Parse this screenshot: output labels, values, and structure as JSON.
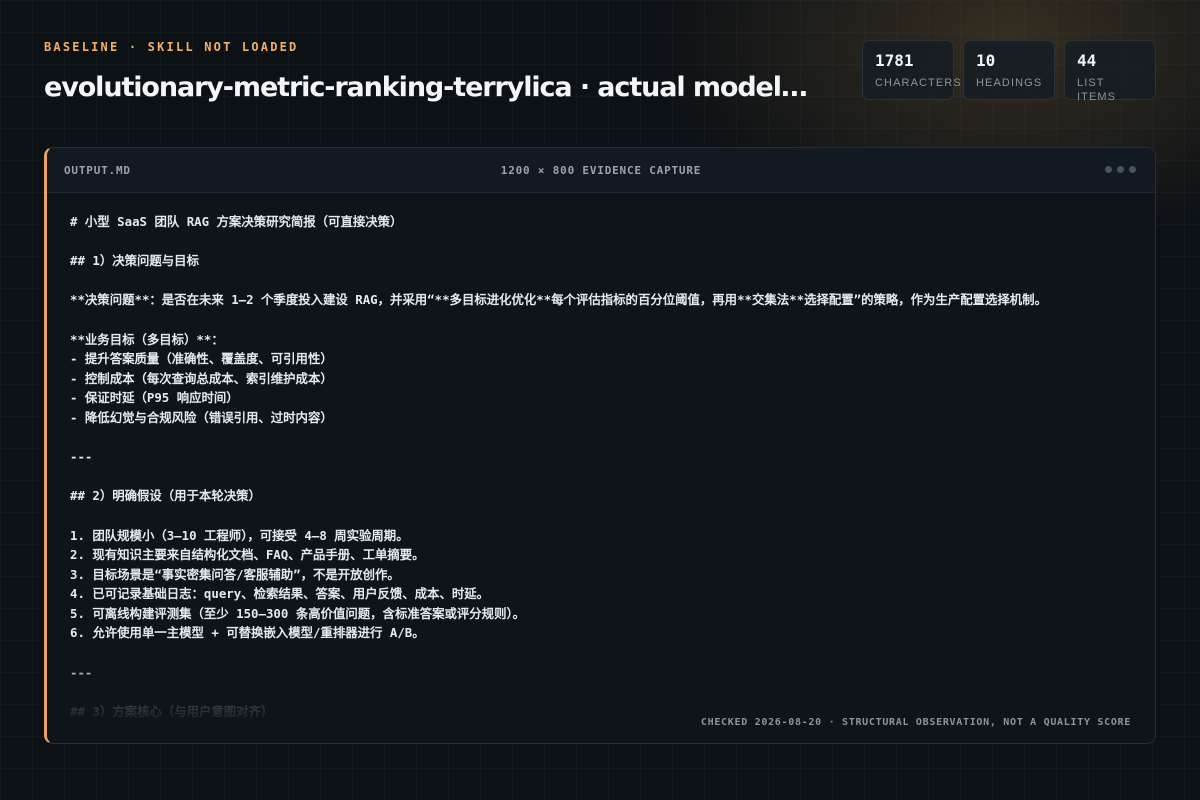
{
  "header": {
    "eyebrow": "BASELINE · SKILL NOT LOADED",
    "title": "evolutionary-metric-ranking-terrylica · actual model arti..."
  },
  "stats": [
    {
      "value": "1781",
      "label": "CHARACTERS"
    },
    {
      "value": "10",
      "label": "HEADINGS"
    },
    {
      "value": "44",
      "label": "LIST ITEMS"
    }
  ],
  "panel": {
    "file_name": "OUTPUT.MD",
    "capture_label": "1200 × 800 EVIDENCE CAPTURE",
    "footer_note": "CHECKED 2026-08-20 · STRUCTURAL OBSERVATION, NOT A QUALITY SCORE",
    "lines": [
      "# 小型 SaaS 团队 RAG 方案决策研究简报（可直接决策）",
      "",
      "## 1）决策问题与目标",
      "",
      "**决策问题**：是否在未来 1–2 个季度投入建设 RAG，并采用“**多目标进化优化**每个评估指标的百分位阈值，再用**交集法**选择配置”的策略，作为生产配置选择机制。",
      "",
      "**业务目标（多目标）**：",
      "- 提升答案质量（准确性、覆盖度、可引用性）",
      "- 控制成本（每次查询总成本、索引维护成本）",
      "- 保证时延（P95 响应时间）",
      "- 降低幻觉与合规风险（错误引用、过时内容）",
      "",
      "---",
      "",
      "## 2）明确假设（用于本轮决策）",
      "",
      "1. 团队规模小（3–10 工程师），可接受 4–8 周实验周期。",
      "2. 现有知识主要来自结构化文档、FAQ、产品手册、工单摘要。",
      "3. 目标场景是“事实密集问答/客服辅助”，不是开放创作。",
      "4. 已可记录基础日志：query、检索结果、答案、用户反馈、成本、时延。",
      "5. 可离线构建评测集（至少 150–300 条高价值问题，含标准答案或评分规则）。",
      "6. 允许使用单一主模型 + 可替换嵌入模型/重排器进行 A/B。",
      "",
      "---",
      "",
      "## 3）方案核心（与用户意图对齐）"
    ]
  }
}
